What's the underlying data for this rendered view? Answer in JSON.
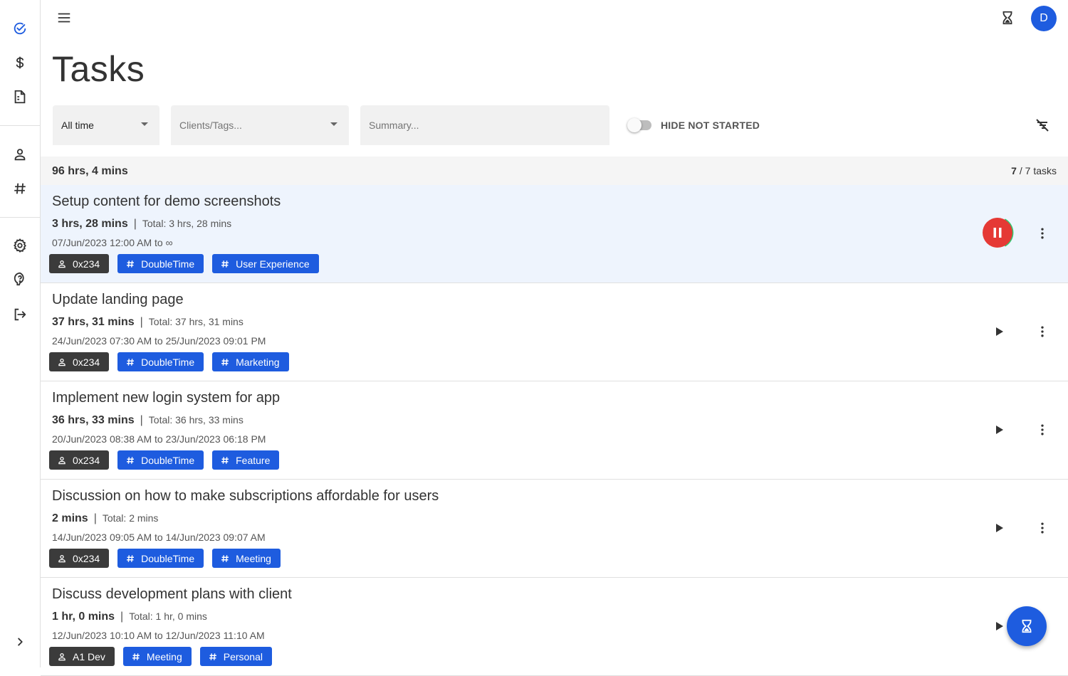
{
  "app": {
    "avatar_initial": "D",
    "accent_color": "#1e5cdf",
    "pause_color": "#e53935"
  },
  "nav": {
    "items": [
      {
        "name": "tasks",
        "icon": "check-circle-icon"
      },
      {
        "name": "billing",
        "icon": "dollar-icon"
      },
      {
        "name": "invoices",
        "icon": "document-icon"
      },
      {
        "name": "clients",
        "icon": "person-icon"
      },
      {
        "name": "tags",
        "icon": "hashtag-icon"
      },
      {
        "name": "settings",
        "icon": "gear-icon"
      },
      {
        "name": "help",
        "icon": "help-icon"
      },
      {
        "name": "logout",
        "icon": "logout-icon"
      }
    ]
  },
  "page": {
    "title": "Tasks"
  },
  "filters": {
    "period_value": "All time",
    "clients_tags_placeholder": "Clients/Tags...",
    "summary_placeholder": "Summary...",
    "hide_not_started_label": "HIDE NOT STARTED",
    "hide_not_started_on": false
  },
  "summary": {
    "total_time": "96 hrs, 4 mins",
    "shown": "7",
    "count_suffix": "/ 7 tasks"
  },
  "tasks": [
    {
      "title": "Setup content for demo screenshots",
      "duration": "3 hrs, 28 mins",
      "total": "Total: 3 hrs, 28 mins",
      "range": "07/Jun/2023 12:00 AM to ∞",
      "client": "0x234",
      "tags": [
        "DoubleTime",
        "User Experience"
      ],
      "running": true
    },
    {
      "title": "Update landing page",
      "duration": "37 hrs, 31 mins",
      "total": "Total: 37 hrs, 31 mins",
      "range": "24/Jun/2023 07:30 AM to 25/Jun/2023 09:01 PM",
      "client": "0x234",
      "tags": [
        "DoubleTime",
        "Marketing"
      ],
      "running": false
    },
    {
      "title": "Implement new login system for app",
      "duration": "36 hrs, 33 mins",
      "total": "Total: 36 hrs, 33 mins",
      "range": "20/Jun/2023 08:38 AM to 23/Jun/2023 06:18 PM",
      "client": "0x234",
      "tags": [
        "DoubleTime",
        "Feature"
      ],
      "running": false
    },
    {
      "title": "Discussion on how to make subscriptions affordable for users",
      "duration": "2 mins",
      "total": "Total: 2 mins",
      "range": "14/Jun/2023 09:05 AM to 14/Jun/2023 09:07 AM",
      "client": "0x234",
      "tags": [
        "DoubleTime",
        "Meeting"
      ],
      "running": false
    },
    {
      "title": "Discuss development plans with client",
      "duration": "1 hr, 0 mins",
      "total": "Total: 1 hr, 0 mins",
      "range": "12/Jun/2023 10:10 AM to 12/Jun/2023 11:10 AM",
      "client": "A1 Dev",
      "tags": [
        "Meeting",
        "Personal"
      ],
      "running": false
    }
  ]
}
